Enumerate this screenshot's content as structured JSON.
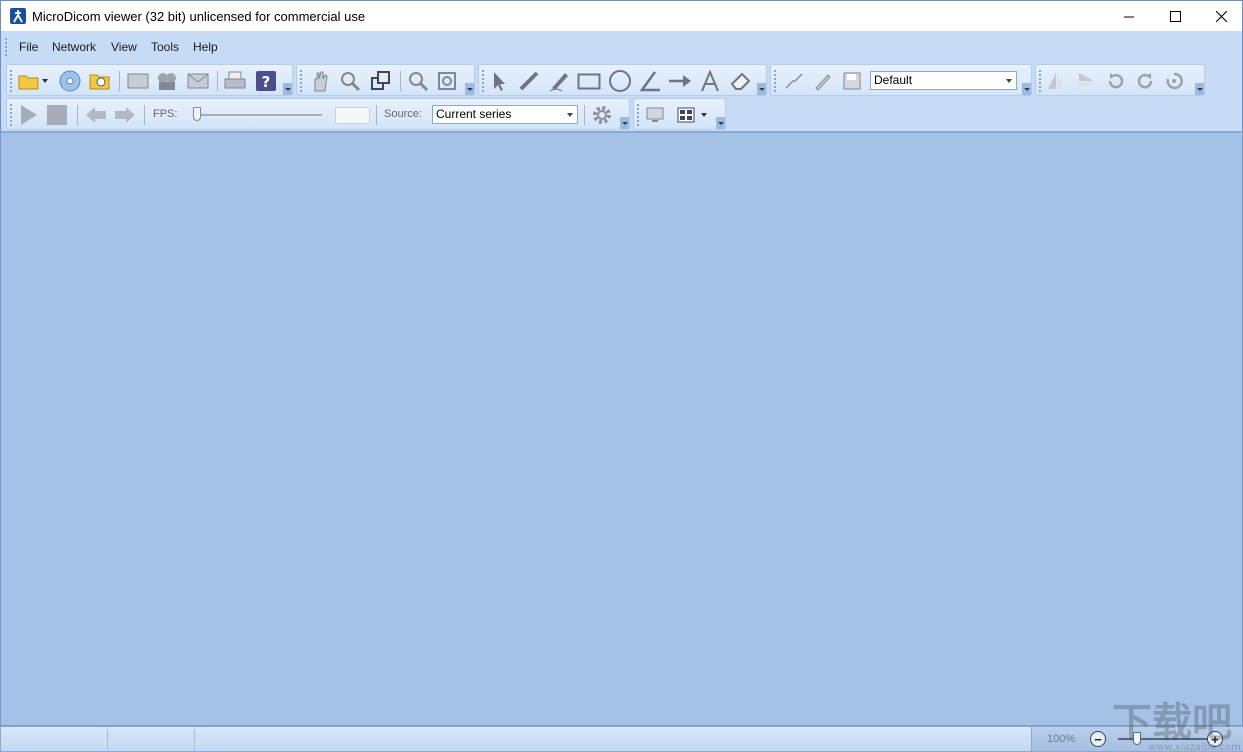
{
  "window": {
    "title": "MicroDicom viewer (32 bit) unlicensed for commercial use",
    "icon": "microdicom-app-icon"
  },
  "menu": {
    "items": [
      "File",
      "Network",
      "View",
      "Tools",
      "Help"
    ]
  },
  "toolbar": {
    "measurement_style": "Default",
    "fps_label": "FPS:",
    "source_label": "Source:",
    "source_value": "Current series"
  },
  "statusbar": {
    "zoom_level": "100%",
    "zoom_out": "−",
    "zoom_in": "+"
  },
  "colors": {
    "workspace": "#a4c2e8",
    "toolbar_bg": "#c6dcf6",
    "accent": "#1a4f9c"
  }
}
